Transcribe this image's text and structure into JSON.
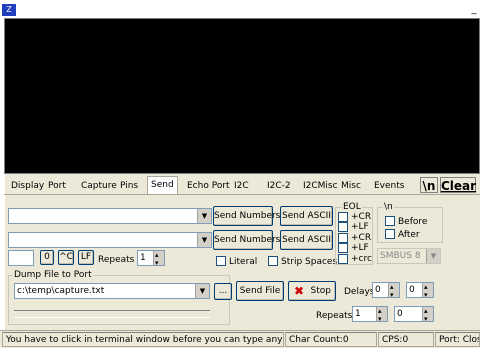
{
  "tabs": [
    "Display",
    "Port",
    "Capture",
    "Pins",
    "Send",
    "Echo Port",
    "I2C",
    "I2C-2",
    "I2CMisc",
    "Misc",
    "Events"
  ],
  "active_tab": "Send",
  "toolbar": {
    "newline_button": "\\n",
    "clear_button": "Clear"
  },
  "send": {
    "send_numbers_1": "Send Numbers",
    "send_ascii_1": "Send ASCII",
    "send_numbers_2": "Send Numbers",
    "send_ascii_2": "Send ASCII",
    "small_field_value": "0",
    "ctrl_c_button": "^C",
    "lf_button": "LF",
    "repeats_label": "Repeats",
    "repeats_value": "1",
    "literal_label": "Literal",
    "strip_spaces_label": "Strip Spaces"
  },
  "eol": {
    "title": "EOL",
    "options": [
      "+CR",
      "+LF",
      "+CR",
      "+LF",
      "+crc"
    ]
  },
  "newline_group": {
    "title": "\\n",
    "before": "Before",
    "after": "After"
  },
  "smbus": {
    "value": "SMBUS 8"
  },
  "dump": {
    "title": "Dump File to Port",
    "path": "c:\\temp\\capture.txt",
    "browse_button": "...",
    "send_file_button": "Send File",
    "stop_button": "Stop",
    "delays_label": "Delays",
    "delay1": "0",
    "delay2": "0",
    "repeats_label": "Repeats",
    "repeats1": "1",
    "repeats2": "0"
  },
  "status": {
    "message": "You have to click in terminal window before you can type any cha",
    "char_count": "Char Count:0",
    "cps": "CPS:0",
    "port": "Port: Clos"
  },
  "colors": {
    "terminal_bg": "#000000",
    "panel_bg": "#ece9d8",
    "stop_icon": "#cc0000"
  }
}
